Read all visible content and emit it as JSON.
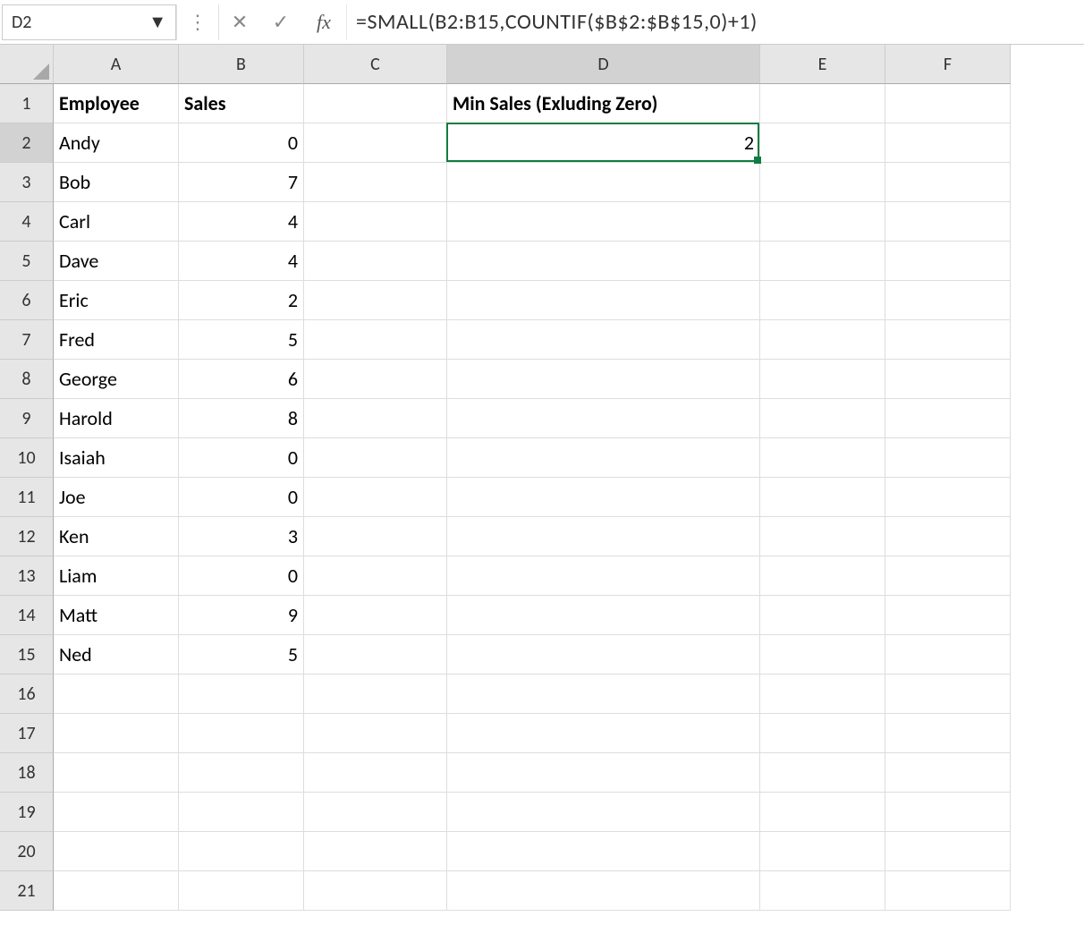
{
  "formula_bar": {
    "name_box": "D2",
    "fx_label": "fx",
    "formula": "=SMALL(B2:B15,COUNTIF($B$2:$B$15,0)+1)"
  },
  "columns": [
    "A",
    "B",
    "C",
    "D",
    "E",
    "F"
  ],
  "active_column_index": 3,
  "row_count": 21,
  "active_row": 2,
  "headers": {
    "A1": "Employee",
    "B1": "Sales",
    "D1": "Min Sales (Exluding Zero)"
  },
  "data": {
    "employees": [
      "Andy",
      "Bob",
      "Carl",
      "Dave",
      "Eric",
      "Fred",
      "George",
      "Harold",
      "Isaiah",
      "Joe",
      "Ken",
      "Liam",
      "Matt",
      "Ned"
    ],
    "sales": [
      0,
      7,
      4,
      4,
      2,
      5,
      6,
      8,
      0,
      0,
      3,
      0,
      9,
      5
    ]
  },
  "result": {
    "D2": 2
  },
  "selection": {
    "cell": "D2"
  }
}
